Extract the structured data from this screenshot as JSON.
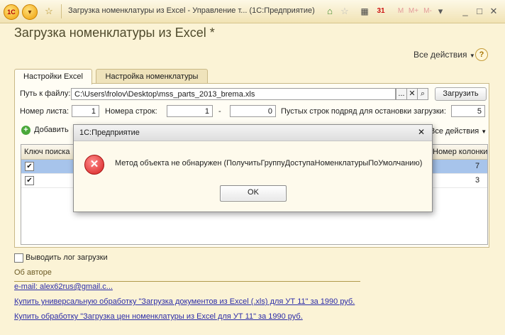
{
  "window": {
    "title": "Загрузка номенклатуры из Excel - Управление т...  (1С:Предприятие)",
    "logo_text": "1С",
    "toolbar_icons": [
      "star-icon",
      "home-icon",
      "history-icon",
      "calculator-icon",
      "calendar-icon"
    ],
    "calendar_text": "31",
    "memory_buttons": [
      "M",
      "M+",
      "M-"
    ],
    "controls": [
      "minimize",
      "restore",
      "close"
    ]
  },
  "form": {
    "title": "Загрузка номенклатуры из Excel *",
    "all_actions": "Все действия",
    "help": "?"
  },
  "tabs": [
    {
      "label": "Настройки Excel",
      "active": true
    },
    {
      "label": "Настройка номенклатуры",
      "active": false
    }
  ],
  "excel": {
    "file_label": "Путь к файлу:",
    "file_value": "C:\\Users\\frolov\\Desktop\\mss_parts_2013_brema.xls",
    "dots_button": "...",
    "clear_button": "✕",
    "load_button": "Загрузить",
    "sheet_label": "Номер листа:",
    "sheet_value": "1",
    "rows_label": "Номера строк:",
    "row_from": "1",
    "row_dash": "-",
    "row_to": "0",
    "empty_rows_label": "Пустых строк подряд для остановки загрузки:",
    "empty_rows_value": "5",
    "add_label": "Добавить",
    "table_all_actions": "Все действия",
    "table": {
      "columns": [
        "Ключ поиска",
        "Номер колонки"
      ],
      "rows": [
        {
          "checked": true,
          "number": "7"
        },
        {
          "checked": true,
          "number": "3"
        }
      ]
    }
  },
  "log_checkbox": "Выводить лог загрузки",
  "footer": {
    "about_label": "Об авторе",
    "links": [
      "e-mail: alex62rus@gmail.c...",
      "Купить универсальную обработку \"Загрузка документов из Excel (.xls) для УТ 11\" за 1990 руб.",
      "Купить обработку \"Загрузка цен номенклатуры из Excel для УТ 11\" за 1990 руб."
    ]
  },
  "dialog": {
    "title": "1С:Предприятие",
    "message": "Метод объекта не обнаружен (ПолучитьГруппуДоступаНоменклатурыПоУмолчанию)",
    "ok": "OK",
    "close": "✕"
  },
  "colors": {
    "background": "#fbf3d6",
    "title_text": "#4f4a2c",
    "link": "#2c2ca8",
    "selection": "#a7c4eb",
    "error": "#d62020"
  }
}
